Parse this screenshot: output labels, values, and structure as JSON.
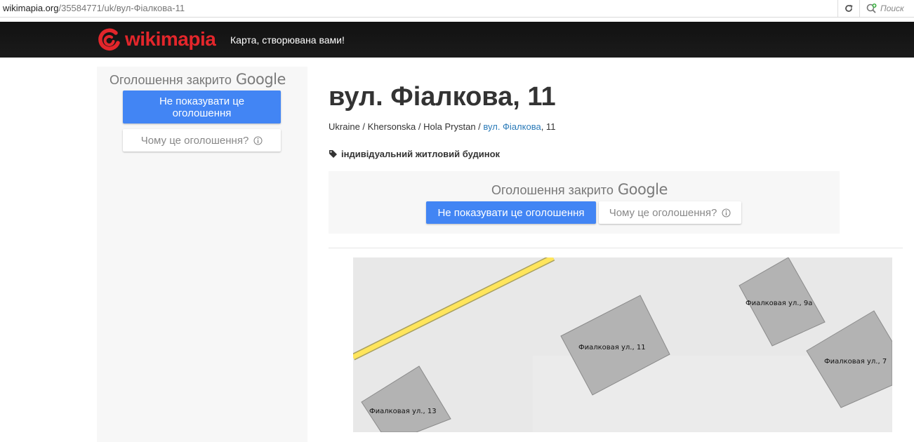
{
  "browser": {
    "url_host": "wikimapia.org",
    "url_path": "/35584771/uk/вул-Фіалкова-11",
    "search_placeholder": "Поиск"
  },
  "header": {
    "brand": "wikimapia",
    "tagline": "Карта, створювана вами!",
    "brand_color": "#e3262b"
  },
  "ad_left": {
    "closed_text": "Оголошення закрито",
    "google": "Google",
    "hide_button": "Не показувати це оголошення",
    "why_button": "Чому це оголошення?"
  },
  "place": {
    "title": "вул. Фіалкова, 11",
    "breadcrumb": {
      "items": [
        "Ukraine",
        "Khersonska",
        "Hola Prystan"
      ],
      "sep": " / ",
      "link": "вул. Фіалкова",
      "suffix": ", 11"
    },
    "category": "індивідуальний житловий будинок"
  },
  "ad_mid": {
    "closed_text": "Оголошення закрито",
    "google": "Google",
    "hide_button": "Не показувати це оголошення",
    "why_button": "Чому це оголошення?"
  },
  "map": {
    "labels": [
      "Фиалковая ул., 11",
      "Фиалковая ул., 9а",
      "Фиалковая ул., 7",
      "Фиалковая ул., 13"
    ],
    "road_color": "#ffe55c",
    "building_fill": "#b3b3b3"
  }
}
